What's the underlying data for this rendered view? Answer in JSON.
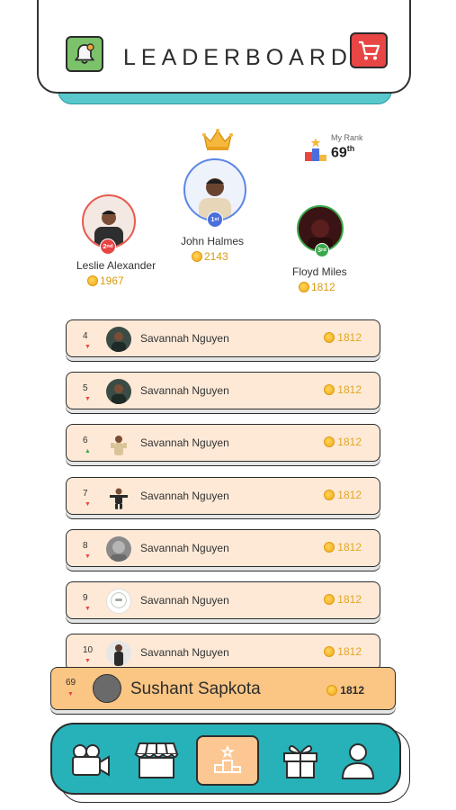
{
  "header": {
    "title": "LEADERBOARD",
    "bell_icon": "bell-icon",
    "cart_icon": "cart-icon"
  },
  "my_rank": {
    "label": "My Rank",
    "value": "69",
    "suffix": "th"
  },
  "podium": [
    {
      "place": "1",
      "suffix": "st",
      "name": "John Halmes",
      "score": "2143",
      "ring_color": "#5b86e5"
    },
    {
      "place": "2",
      "suffix": "nd",
      "name": "Leslie Alexander",
      "score": "1967",
      "ring_color": "#e85a4f"
    },
    {
      "place": "3",
      "suffix": "rd",
      "name": "Floyd Miles",
      "score": "1812",
      "ring_color": "#3aa74a"
    }
  ],
  "rows": [
    {
      "rank": "4",
      "trend": "down",
      "name": "Savannah Nguyen",
      "score": "1812"
    },
    {
      "rank": "5",
      "trend": "down",
      "name": "Savannah Nguyen",
      "score": "1812"
    },
    {
      "rank": "6",
      "trend": "up",
      "name": "Savannah Nguyen",
      "score": "1812"
    },
    {
      "rank": "7",
      "trend": "down",
      "name": "Savannah Nguyen",
      "score": "1812"
    },
    {
      "rank": "8",
      "trend": "down",
      "name": "Savannah Nguyen",
      "score": "1812"
    },
    {
      "rank": "9",
      "trend": "down",
      "name": "Savannah Nguyen",
      "score": "1812"
    },
    {
      "rank": "10",
      "trend": "down",
      "name": "Savannah Nguyen",
      "score": "1812"
    }
  ],
  "me": {
    "rank": "69",
    "trend": "down",
    "name": "Sushant Sapkota",
    "score": "1812"
  },
  "nav": [
    {
      "icon": "video-camera-icon",
      "active": false
    },
    {
      "icon": "store-icon",
      "active": false
    },
    {
      "icon": "podium-icon",
      "active": true
    },
    {
      "icon": "gift-icon",
      "active": false
    },
    {
      "icon": "profile-icon",
      "active": false
    }
  ],
  "colors": {
    "accent": "#27b1b8",
    "row_bg": "#fde9d6",
    "me_bg": "#fbc584",
    "coin": "#f0a818"
  }
}
